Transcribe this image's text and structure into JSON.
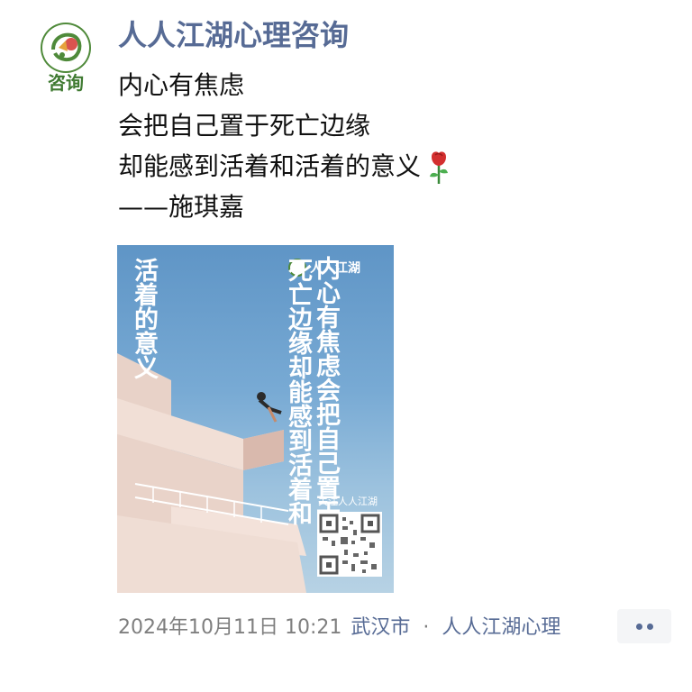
{
  "post": {
    "author": "人人江湖心理咨询",
    "avatar_label": "咨询",
    "lines": [
      "内心有焦虑",
      "会把自己置于死亡边缘",
      "却能感到活着和活着的意义",
      "——施琪嘉"
    ],
    "emoji": "rose-icon"
  },
  "poster": {
    "brand": "人人江湖",
    "column1": "内心有焦虑会把自己置于",
    "column2": "死亡边缘却能感到活着和",
    "column3": "活着的意义",
    "follow_text": "关注人人江湖",
    "qr": "qr-code"
  },
  "footer": {
    "time": "2024年10月11日 10:21",
    "location": "武汉市",
    "separator": "·",
    "source": "人人江湖心理"
  },
  "colors": {
    "link": "#576b95",
    "brand_green": "#4f8a3a",
    "meta": "#7f7f7f"
  }
}
